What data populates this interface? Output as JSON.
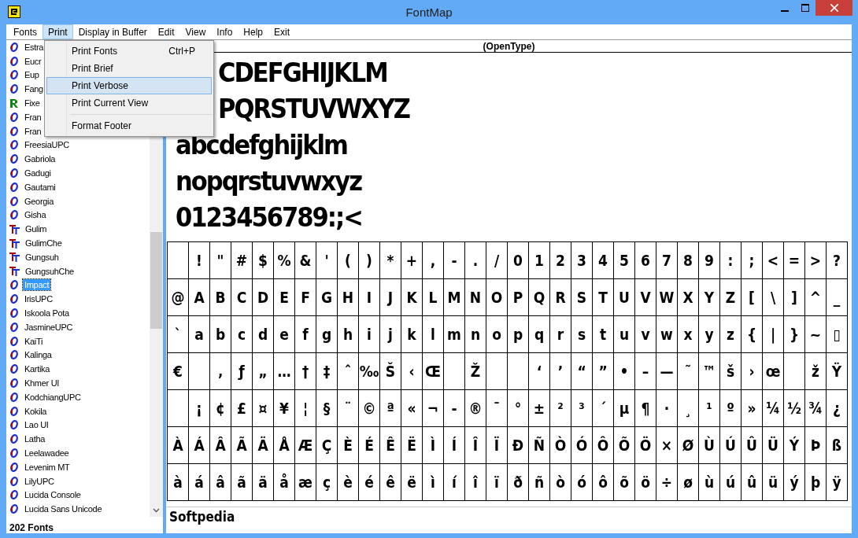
{
  "window": {
    "title": "FontMap"
  },
  "menu_bar": [
    {
      "label": "Fonts",
      "selected": false
    },
    {
      "label": "Print",
      "selected": true
    },
    {
      "label": "Display in Buffer",
      "selected": false
    },
    {
      "label": "Edit",
      "selected": false
    },
    {
      "label": "View",
      "selected": false
    },
    {
      "label": "Info",
      "selected": false
    },
    {
      "label": "Help",
      "selected": false
    },
    {
      "label": "Exit",
      "selected": false
    }
  ],
  "print_menu": {
    "items": [
      {
        "kind": "item",
        "label": "Print Fonts",
        "shortcut": "Ctrl+P",
        "selected": false
      },
      {
        "kind": "item",
        "label": "Print Brief",
        "selected": false
      },
      {
        "kind": "item",
        "label": "Print Verbose",
        "selected": true
      },
      {
        "kind": "item",
        "label": "Print Current View",
        "selected": false
      },
      {
        "kind": "separator"
      },
      {
        "kind": "item",
        "label": "Format Footer",
        "selected": false
      }
    ]
  },
  "font_list": {
    "items": [
      {
        "name": "Estra",
        "kind": "opentype",
        "selected": false
      },
      {
        "name": "Eucr",
        "kind": "opentype",
        "selected": false
      },
      {
        "name": "Eup",
        "kind": "opentype",
        "selected": false
      },
      {
        "name": "Fang",
        "kind": "opentype",
        "selected": false
      },
      {
        "name": "Fixe",
        "kind": "raster",
        "selected": false
      },
      {
        "name": "Fran",
        "kind": "opentype",
        "selected": false
      },
      {
        "name": "Fran",
        "kind": "opentype",
        "selected": false
      },
      {
        "name": "FreesiaUPC",
        "kind": "opentype",
        "selected": false
      },
      {
        "name": "Gabriola",
        "kind": "opentype",
        "selected": false
      },
      {
        "name": "Gadugi",
        "kind": "opentype",
        "selected": false
      },
      {
        "name": "Gautami",
        "kind": "opentype",
        "selected": false
      },
      {
        "name": "Georgia",
        "kind": "opentype",
        "selected": false
      },
      {
        "name": "Gisha",
        "kind": "opentype",
        "selected": false
      },
      {
        "name": "Gulim",
        "kind": "truetype",
        "selected": false
      },
      {
        "name": "GulimChe",
        "kind": "truetype",
        "selected": false
      },
      {
        "name": "Gungsuh",
        "kind": "truetype",
        "selected": false
      },
      {
        "name": "GungsuhChe",
        "kind": "truetype",
        "selected": false
      },
      {
        "name": "Impact",
        "kind": "opentype",
        "selected": true
      },
      {
        "name": "IrisUPC",
        "kind": "opentype",
        "selected": false
      },
      {
        "name": "Iskoola Pota",
        "kind": "opentype",
        "selected": false
      },
      {
        "name": "JasmineUPC",
        "kind": "opentype",
        "selected": false
      },
      {
        "name": "KaiTi",
        "kind": "opentype",
        "selected": false
      },
      {
        "name": "Kalinga",
        "kind": "opentype",
        "selected": false
      },
      {
        "name": "Kartika",
        "kind": "opentype",
        "selected": false
      },
      {
        "name": "Khmer UI",
        "kind": "opentype",
        "selected": false
      },
      {
        "name": "KodchiangUPC",
        "kind": "opentype",
        "selected": false
      },
      {
        "name": "Kokila",
        "kind": "opentype",
        "selected": false
      },
      {
        "name": "Lao UI",
        "kind": "opentype",
        "selected": false
      },
      {
        "name": "Latha",
        "kind": "opentype",
        "selected": false
      },
      {
        "name": "Leelawadee",
        "kind": "opentype",
        "selected": false
      },
      {
        "name": "Levenim MT",
        "kind": "opentype",
        "selected": false
      },
      {
        "name": "LilyUPC",
        "kind": "opentype",
        "selected": false
      },
      {
        "name": "Lucida Console",
        "kind": "opentype",
        "selected": false
      },
      {
        "name": "Lucida Sans Unicode",
        "kind": "opentype",
        "selected": false
      }
    ],
    "count": "202 Fonts"
  },
  "preview": {
    "font_type": "(OpenType)",
    "sample_lines": [
      {
        "text": "CDEFGHIJKLM",
        "covered": true
      },
      {
        "text": "PQRSTUVWXYZ",
        "covered": true
      },
      {
        "text": "abcdefghijklm"
      },
      {
        "text": "nopqrstuvwxyz"
      },
      {
        "text": "0123456789:;<"
      }
    ],
    "glyph_rows": [
      [
        null,
        "!",
        "\"",
        "#",
        "$",
        "%",
        "&",
        "'",
        "(",
        ")",
        "*",
        "+",
        ",",
        "-",
        ".",
        "/",
        "0",
        "1",
        "2",
        "3",
        "4",
        "5",
        "6",
        "7",
        "8",
        "9",
        ":",
        ";",
        "<",
        "=",
        ">",
        "?"
      ],
      [
        "@",
        "A",
        "B",
        "C",
        "D",
        "E",
        "F",
        "G",
        "H",
        "I",
        "J",
        "K",
        "L",
        "M",
        "N",
        "O",
        "P",
        "Q",
        "R",
        "S",
        "T",
        "U",
        "V",
        "W",
        "X",
        "Y",
        "Z",
        "[",
        "\\",
        "]",
        "^",
        "_"
      ],
      [
        "`",
        "a",
        "b",
        "c",
        "d",
        "e",
        "f",
        "g",
        "h",
        "i",
        "j",
        "k",
        "l",
        "m",
        "n",
        "o",
        "p",
        "q",
        "r",
        "s",
        "t",
        "u",
        "v",
        "w",
        "x",
        "y",
        "z",
        "{",
        "|",
        "}",
        "~",
        "▯"
      ],
      [
        "€",
        null,
        "‚",
        "ƒ",
        "„",
        "…",
        "†",
        "‡",
        "ˆ",
        "‰",
        "Š",
        "‹",
        "Œ",
        null,
        "Ž",
        null,
        null,
        "‘",
        "’",
        "“",
        "”",
        "•",
        "–",
        "—",
        "˜",
        "™",
        "š",
        "›",
        "œ",
        null,
        "ž",
        "Ÿ"
      ],
      [
        null,
        "¡",
        "¢",
        "£",
        "¤",
        "¥",
        "¦",
        "§",
        "¨",
        "©",
        "ª",
        "«",
        "¬",
        "-",
        "®",
        "¯",
        "°",
        "±",
        "²",
        "³",
        "´",
        "µ",
        "¶",
        "·",
        "¸",
        "¹",
        "º",
        "»",
        "¼",
        "½",
        "¾",
        "¿"
      ],
      [
        "À",
        "Á",
        "Â",
        "Ã",
        "Ä",
        "Å",
        "Æ",
        "Ç",
        "È",
        "É",
        "Ê",
        "Ë",
        "Ì",
        "Í",
        "Î",
        "Ï",
        "Ð",
        "Ñ",
        "Ò",
        "Ó",
        "Ô",
        "Õ",
        "Ö",
        "×",
        "Ø",
        "Ù",
        "Ú",
        "Û",
        "Ü",
        "Ý",
        "Þ",
        "ß"
      ],
      [
        "à",
        "á",
        "â",
        "ã",
        "ä",
        "å",
        "æ",
        "ç",
        "è",
        "é",
        "ê",
        "ë",
        "ì",
        "í",
        "î",
        "ï",
        "ð",
        "ñ",
        "ò",
        "ó",
        "ô",
        "õ",
        "ö",
        "÷",
        "ø",
        "ù",
        "ú",
        "û",
        "ü",
        "ý",
        "þ",
        "ÿ"
      ]
    ],
    "buffer": {
      "value": "Softpedia"
    }
  }
}
